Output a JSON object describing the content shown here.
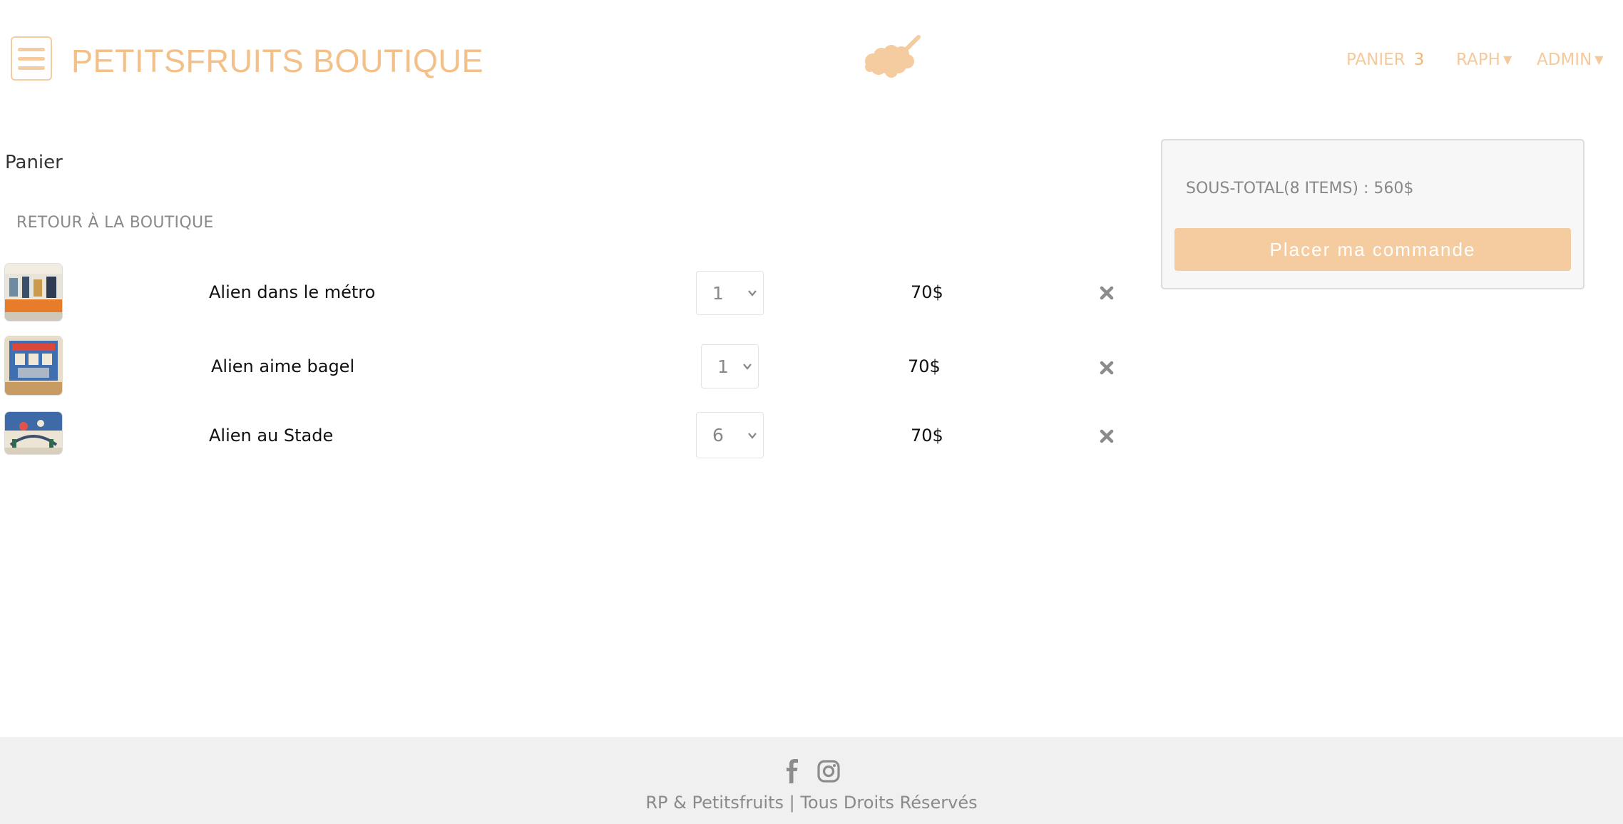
{
  "header": {
    "brand": "PETITSFRUITS BOUTIQUE",
    "nav": {
      "cart_label": "PANIER",
      "cart_count": "3",
      "user_label": "RAPH",
      "admin_label": "ADMIN"
    }
  },
  "cart": {
    "heading": "Panier",
    "back_link": "RETOUR À LA BOUTIQUE",
    "items": [
      {
        "name": "Alien dans le métro",
        "quantity": "1",
        "price": "70$"
      },
      {
        "name": "Alien aime bagel",
        "quantity": "1",
        "price": "70$"
      },
      {
        "name": "Alien au Stade",
        "quantity": "6",
        "price": "70$"
      }
    ]
  },
  "summary": {
    "subtotal": "SOUS-TOTAL(8 ITEMS) : 560$",
    "order_button": "Placer ma commande"
  },
  "footer": {
    "copyright": "RP & Petitsfruits | Tous Droits Réservés"
  },
  "colors": {
    "accent": "#f5cc9f",
    "brand_text": "#f3c089",
    "footer_bg": "#f0f0f0"
  },
  "icons": [
    "menu-icon",
    "raspberry-logo",
    "caret-down-icon",
    "chevron-down-icon",
    "remove-icon",
    "facebook-icon",
    "instagram-icon"
  ]
}
